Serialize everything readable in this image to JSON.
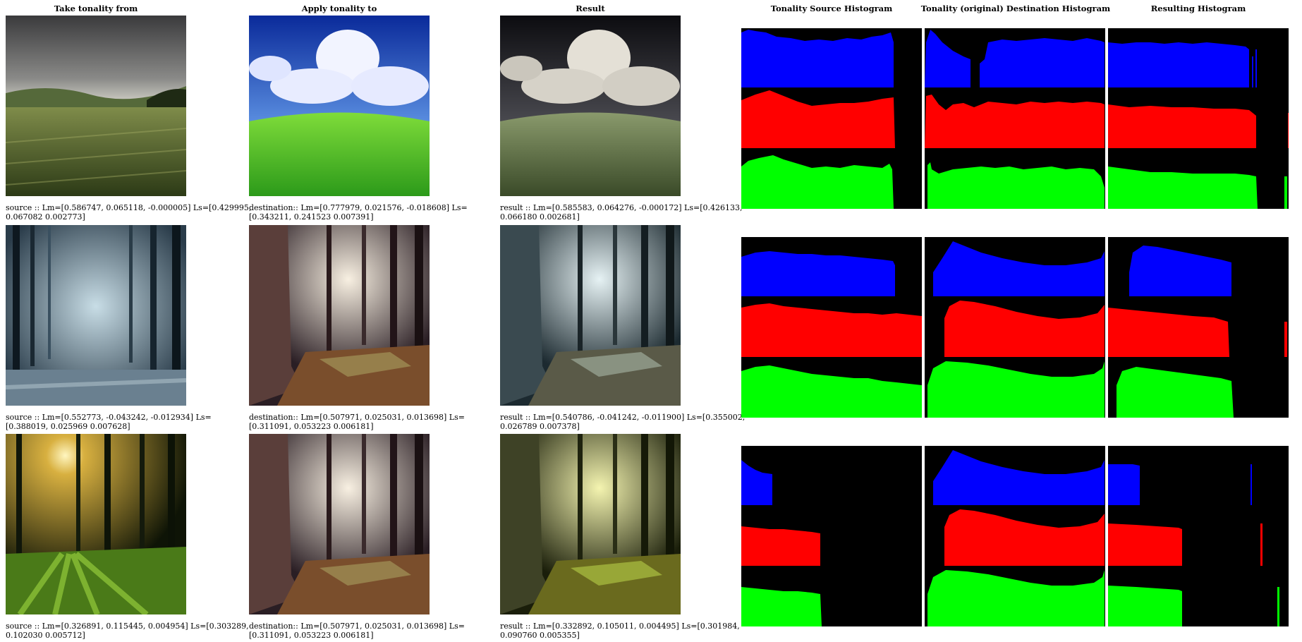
{
  "headers": {
    "source": "Take tonality from",
    "destination": "Apply tonality to",
    "result": "Result",
    "src_hist": "Tonality Source Histogram",
    "dst_hist": "Tonality (original) Destination Histogram",
    "res_hist": "Resulting Histogram"
  },
  "rows": [
    {
      "source_caption": "source :: Lm=[0.586747, 0.065118, -0.000005] Ls=[0.429995, 0.067082 0.002773]",
      "destination_caption": "destination:: Lm=[0.777979, 0.021576, -0.018608] Ls=[0.343211, 0.241523 0.007391]",
      "result_caption": "result :: Lm=[0.585583, 0.064276, -0.000172] Ls=[0.426133, 0.066180 0.002681]"
    },
    {
      "source_caption": "source :: Lm=[0.552773, -0.043242, -0.012934] Ls=[0.388019, 0.025969 0.007628]",
      "destination_caption": "destination:: Lm=[0.507971, 0.025031, 0.013698] Ls=[0.311091, 0.053223 0.006181]",
      "result_caption": "result :: Lm=[0.540786, -0.041242, -0.011900] Ls=[0.355002, 0.026789 0.007378]"
    },
    {
      "source_caption": "source :: Lm=[0.326891, 0.115445, 0.004954] Ls=[0.303289, 0.102030 0.005712]",
      "destination_caption": "destination:: Lm=[0.507971, 0.025031, 0.013698] Ls=[0.311091, 0.053223 0.006181]",
      "result_caption": "result :: Lm=[0.332892, 0.105011, 0.004495] Ls=[0.301984, 0.090760 0.005355]"
    }
  ],
  "colors": {
    "hist_blue": "#0000ff",
    "hist_red": "#ff0000",
    "hist_green": "#00ff00",
    "hist_bg": "#000000"
  }
}
